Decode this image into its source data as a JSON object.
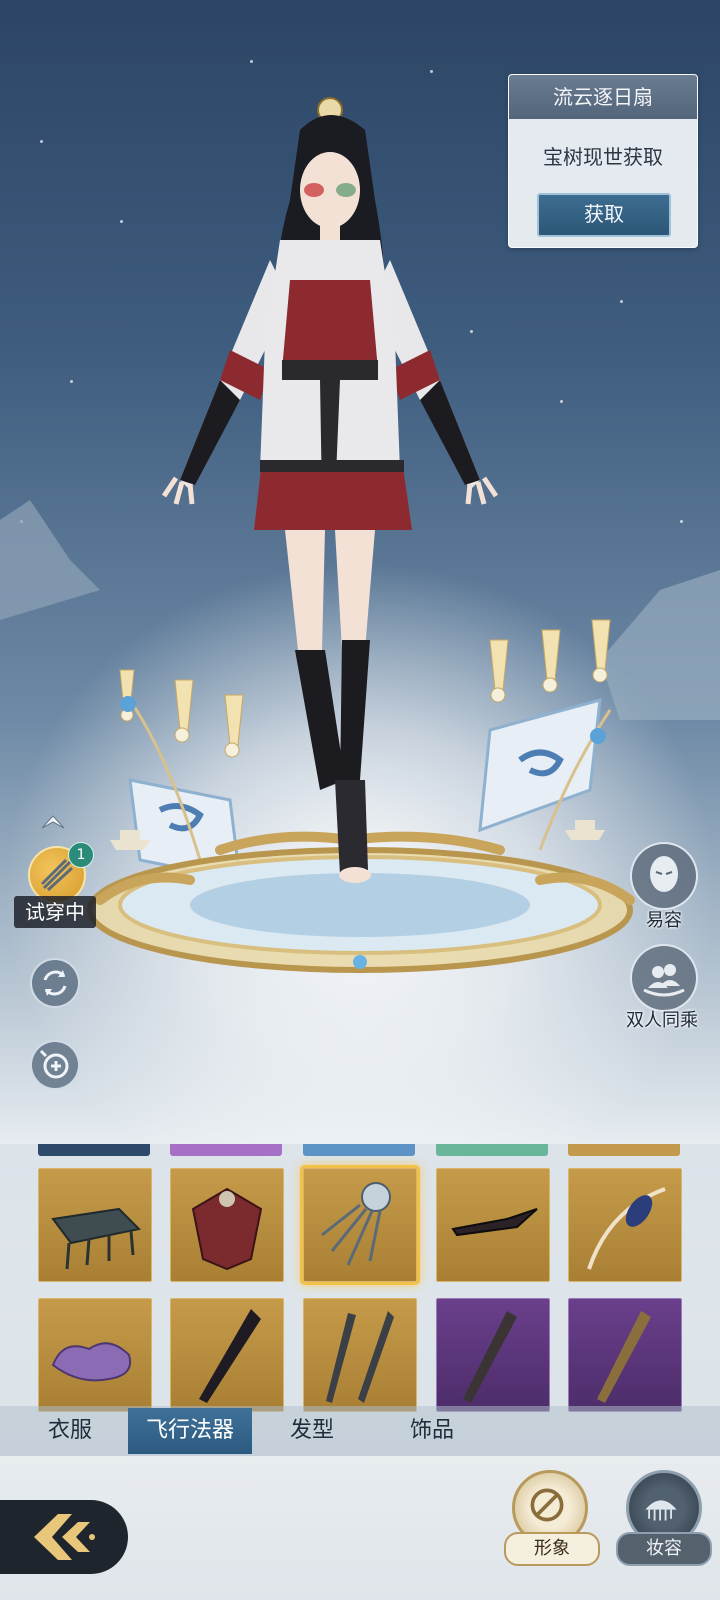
{
  "item_card": {
    "title": "流云逐日扇",
    "source": "宝树现世获取",
    "obtain_button": "获取"
  },
  "left_controls": {
    "try_on_badge_count": "1",
    "try_on_label": "试穿中"
  },
  "right_controls": {
    "face_label": "易容",
    "duo_ride_label": "双人同乘"
  },
  "grid": {
    "row1": [
      "gold",
      "gold",
      "gold",
      "gold",
      "gold"
    ],
    "row2": [
      "gold",
      "gold",
      "gold",
      "purple",
      "purple"
    ],
    "selected_index": 2,
    "top_strip_colors": [
      "#2e4a6a",
      "#a670c6",
      "#5d93c6",
      "#6ab69a",
      "#c39a4c"
    ]
  },
  "tabs": [
    {
      "label": "衣服",
      "active": false
    },
    {
      "label": "飞行法器",
      "active": true
    },
    {
      "label": "发型",
      "active": false
    },
    {
      "label": "饰品",
      "active": false
    }
  ],
  "bottom": {
    "appearance_label": "形象",
    "makeup_label": "妆容"
  },
  "colors": {
    "accent_blue": "#2c5a80",
    "gold": "#c59b4a",
    "purple": "#5a3579"
  }
}
